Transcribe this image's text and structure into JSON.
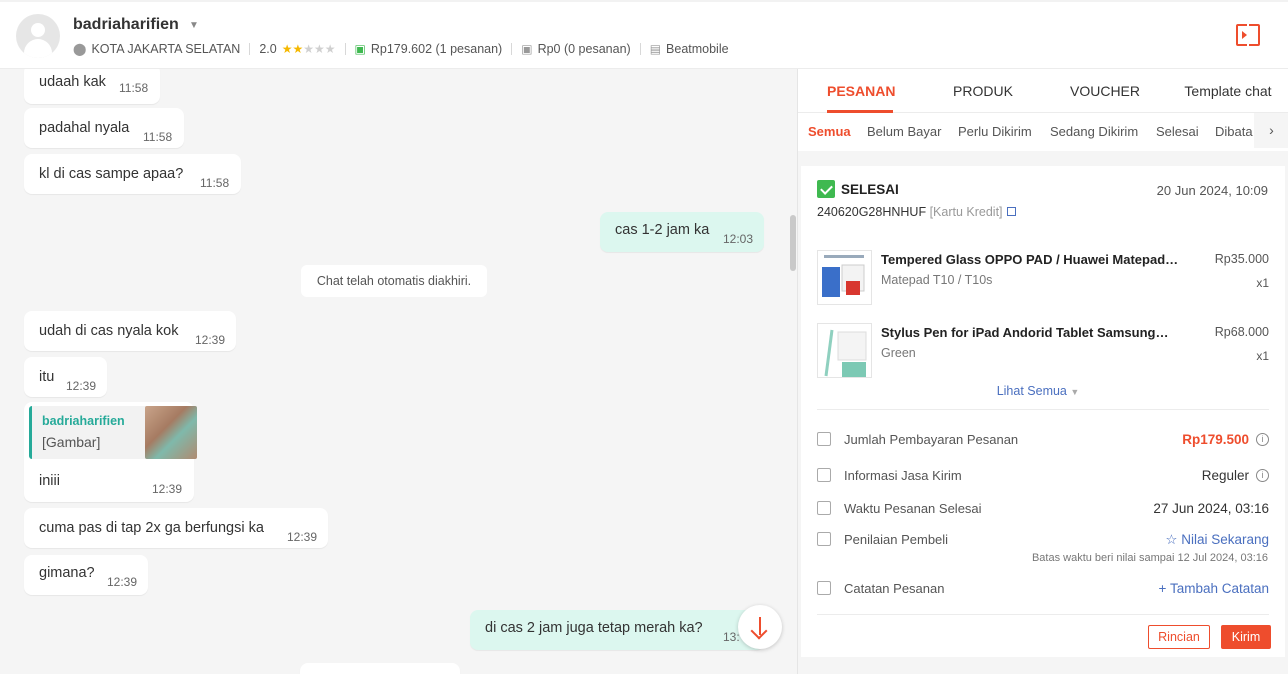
{
  "header": {
    "username": "badriaharifien",
    "location": "KOTA JAKARTA SELATAN",
    "rating": "2.0",
    "rating_stars_filled": 2,
    "rating_stars_total": 5,
    "paid_total": "Rp179.602 (1 pesanan)",
    "unpaid_total": "Rp0 (0 pesanan)",
    "shop": "Beatmobile"
  },
  "chat": {
    "messages": [
      {
        "text": "udaah kak",
        "time": "11:58",
        "dir": "in"
      },
      {
        "text": "padahal nyala",
        "time": "11:58",
        "dir": "in"
      },
      {
        "text": "kl di cas sampe apaa?",
        "time": "11:58",
        "dir": "in"
      },
      {
        "text": "cas 1-2 jam ka",
        "time": "12:03",
        "dir": "out"
      },
      {
        "text": "udah di cas nyala kok",
        "time": "12:39",
        "dir": "in"
      },
      {
        "text": "itu",
        "time": "12:39",
        "dir": "in"
      },
      {
        "text": "iniii",
        "time": "12:39",
        "dir": "in",
        "quote_name": "badriaharifien",
        "quote_text": "[Gambar]"
      },
      {
        "text": "cuma pas di tap 2x ga berfungsi ka",
        "time": "12:39",
        "dir": "in"
      },
      {
        "text": "gimana?",
        "time": "12:39",
        "dir": "in"
      },
      {
        "text": "di cas 2 jam juga tetap merah ka?",
        "time": "13:",
        "dir": "out"
      }
    ],
    "system_notice": "Chat telah otomatis diakhiri."
  },
  "panel": {
    "tabs": [
      "PESANAN",
      "PRODUK",
      "VOUCHER",
      "Template chat"
    ],
    "active_tab": "PESANAN",
    "subtabs": [
      "Semua",
      "Belum Bayar",
      "Perlu Dikirim",
      "Sedang Dikirim",
      "Selesai",
      "Dibata"
    ],
    "active_subtab": "Semua",
    "order": {
      "status": "SELESAI",
      "date": "20 Jun 2024, 10:09",
      "order_id": "240620G28HNHUF",
      "payment": "[Kartu Kredit]",
      "products": [
        {
          "name": "Tempered Glass OPPO PAD / Huawei Matepad…",
          "variant": "Matepad T10 / T10s",
          "price": "Rp35.000",
          "qty": "x1"
        },
        {
          "name": "Stylus Pen for iPad Andorid Tablet Samsung…",
          "variant": "Green",
          "price": "Rp68.000",
          "qty": "x1"
        }
      ],
      "see_all": "Lihat Semua",
      "payment_label": "Jumlah Pembayaran Pesanan",
      "payment_value": "Rp179.500",
      "shipping_label": "Informasi Jasa Kirim",
      "shipping_value": "Reguler",
      "completed_label": "Waktu Pesanan Selesai",
      "completed_value": "27 Jun 2024, 03:16",
      "review_label": "Penilaian Pembeli",
      "review_action": "Nilai Sekarang",
      "review_deadline": "Batas waktu beri nilai sampai 12 Jul 2024, 03:16",
      "note_label": "Catatan Pesanan",
      "note_action": "Tambah Catatan",
      "btn_detail": "Rincian",
      "btn_send": "Kirim"
    }
  },
  "colors": {
    "accent": "#ee4d2d",
    "outgoing_bubble": "#dcf7ef",
    "quote_accent": "#26aa99",
    "link": "#4a6fbf"
  }
}
